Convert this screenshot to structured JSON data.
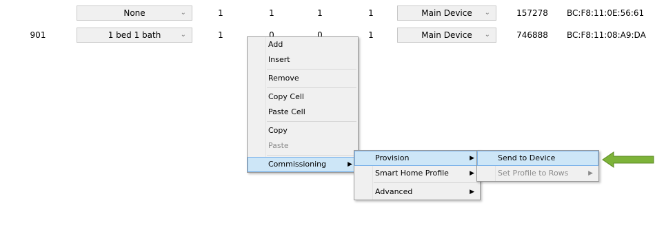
{
  "rows": [
    {
      "room": "",
      "type": "None",
      "c1": "1",
      "c2": "1",
      "c3": "1",
      "c4": "1",
      "device": "Main Device",
      "serial": "157278",
      "mac": "BC:F8:11:0E:56:61"
    },
    {
      "room": "901",
      "type": "1 bed 1 bath",
      "c1": "1",
      "c2": "0",
      "c3": "0",
      "c4": "1",
      "device": "Main Device",
      "serial": "746888",
      "mac": "BC:F8:11:08:A9:DA"
    }
  ],
  "context_menu": {
    "items": [
      {
        "label": "Add"
      },
      {
        "label": "Insert"
      },
      {
        "label": "Remove"
      },
      {
        "label": "Copy Cell"
      },
      {
        "label": "Paste Cell"
      },
      {
        "label": "Copy"
      },
      {
        "label": "Paste"
      },
      {
        "label": "Commissioning"
      }
    ]
  },
  "commissioning_menu": {
    "items": [
      {
        "label": "Provision"
      },
      {
        "label": "Smart Home Profile"
      },
      {
        "label": "Advanced"
      }
    ]
  },
  "provision_menu": {
    "items": [
      {
        "label": "Send to Device"
      },
      {
        "label": "Set Profile to Rows"
      }
    ]
  },
  "colors": {
    "highlight": "#cde6f7",
    "annotation_arrow": "#7db339"
  },
  "icons": {
    "dropdown": "chevron-down-icon",
    "submenu": "submenu-arrow-icon",
    "annotation": "green-arrow-icon"
  }
}
